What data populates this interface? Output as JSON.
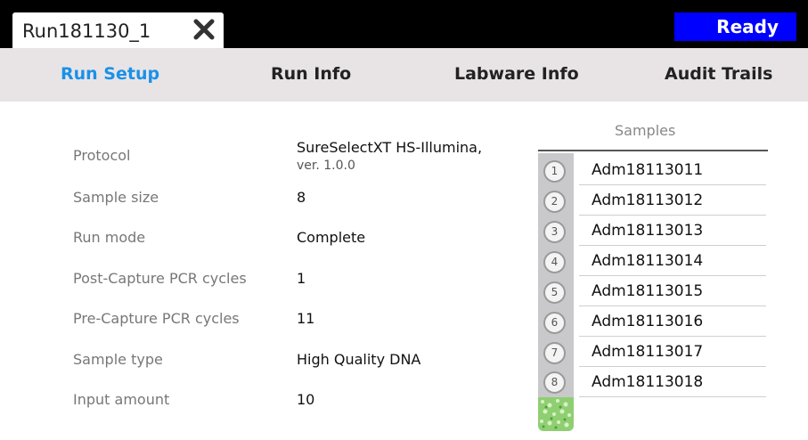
{
  "window": {
    "tab_title": "Run181130_1",
    "close_icon": "close-icon",
    "status": "Ready",
    "status_color": "#0000ff"
  },
  "nav": {
    "tabs": [
      {
        "label": "Run Setup",
        "active": true
      },
      {
        "label": "Run Info"
      },
      {
        "label": "Labware Info"
      },
      {
        "label": "Audit Trails"
      }
    ],
    "active_color": "#1a91e8"
  },
  "properties": [
    {
      "label": "Protocol",
      "value": "SureSelectXT HS-Illumina,",
      "sub": "ver. 1.0.0"
    },
    {
      "label": "Sample size",
      "value": "8"
    },
    {
      "label": "Run mode",
      "value": "Complete"
    },
    {
      "label": "Post-Capture PCR cycles",
      "value": "1"
    },
    {
      "label": "Pre-Capture PCR cycles",
      "value": "11"
    },
    {
      "label": "Sample type",
      "value": "High Quality DNA"
    },
    {
      "label": "Input amount",
      "value": "10"
    }
  ],
  "samples": {
    "title": "Samples",
    "items": [
      {
        "index": "1",
        "name": "Adm18113011"
      },
      {
        "index": "2",
        "name": "Adm18113012"
      },
      {
        "index": "3",
        "name": "Adm18113013"
      },
      {
        "index": "4",
        "name": "Adm18113014"
      },
      {
        "index": "5",
        "name": "Adm18113015"
      },
      {
        "index": "6",
        "name": "Adm18113016"
      },
      {
        "index": "7",
        "name": "Adm18113017"
      },
      {
        "index": "8",
        "name": "Adm18113018"
      }
    ],
    "tube_icon": "green-sample-tube-icon"
  }
}
